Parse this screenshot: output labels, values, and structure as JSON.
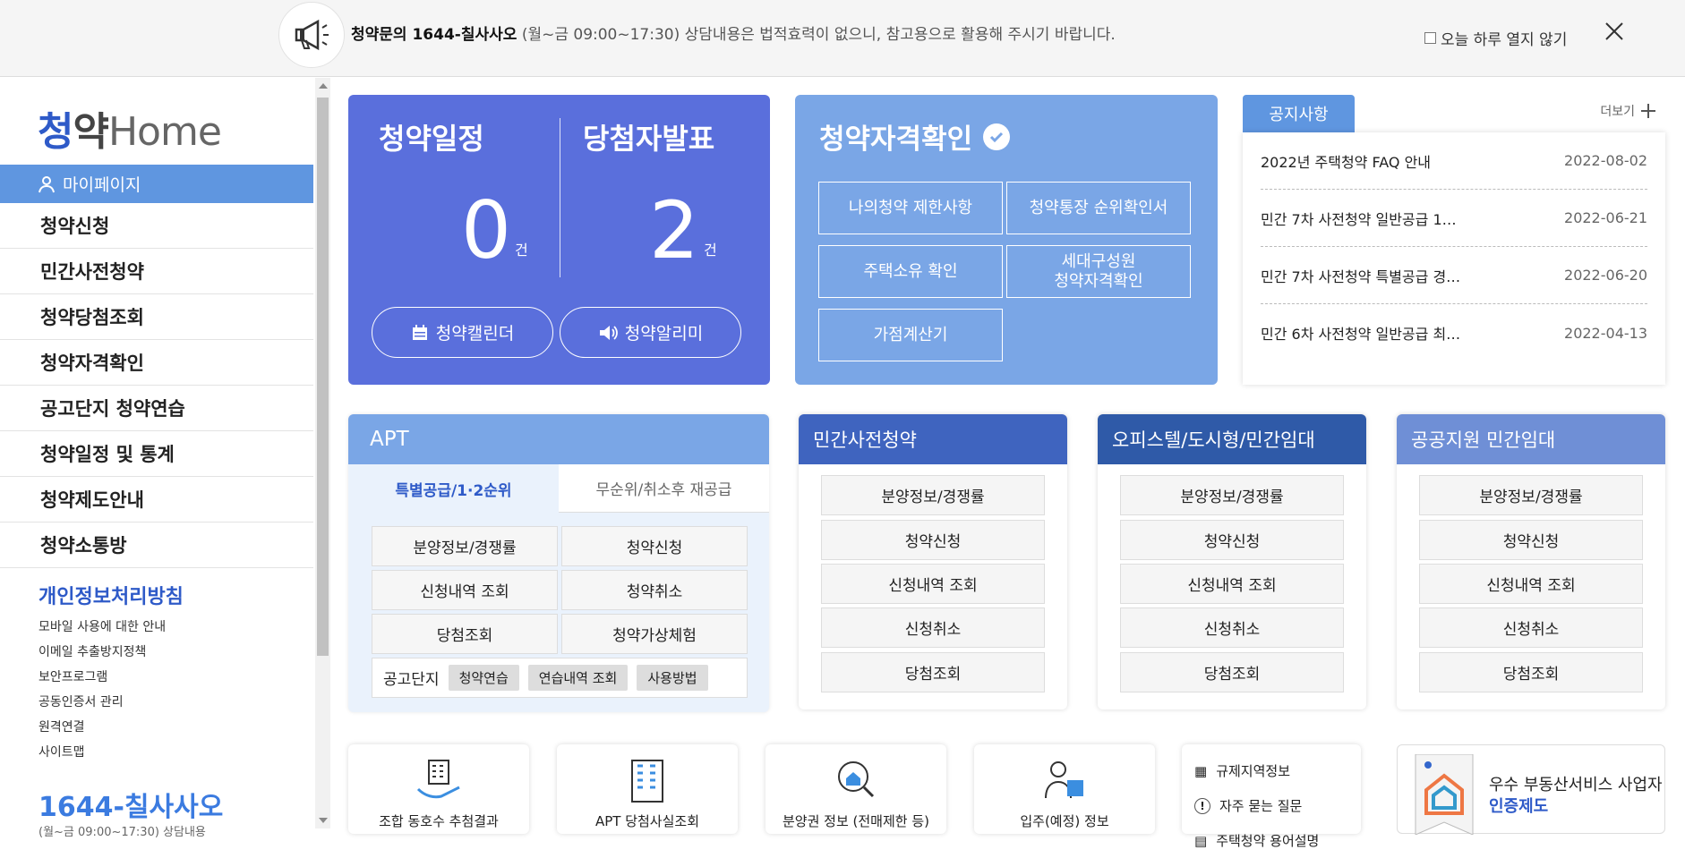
{
  "topbar": {
    "notice_bold": "청약문의 1644-칠사사오",
    "notice_rest": " (월~금 09:00~17:30) 상담내용은 법적효력이 없으니, 참고용으로 활용해 주시기 바랍니다.",
    "dismiss_label": "오늘 하루 열지 않기"
  },
  "sidebar": {
    "logo_1": "청",
    "logo_2": "약",
    "logo_3": "Home",
    "mypage": "마이페이지",
    "menu": [
      "청약신청",
      "민간사전청약",
      "청약당첨조회",
      "청약자격확인",
      "공고단지 청약연습",
      "청약일정 및 통계",
      "청약제도안내",
      "청약소통방"
    ],
    "policy": "개인정보처리방침",
    "links": [
      "모바일 사용에 대한 안내",
      "이메일 추출방지정책",
      "보안프로그램",
      "공동인증서 관리",
      "원격연결",
      "사이트맵"
    ],
    "phone": "1644-칠사사오",
    "phone_sub": "(월~금 09:00~17:30) 상담내용"
  },
  "schedule": {
    "title1": "청약일정",
    "title2": "당첨자발표",
    "count1": "0",
    "count2": "2",
    "unit": "건",
    "btn_calendar": "청약캘린더",
    "btn_alarm": "청약알리미"
  },
  "qualify": {
    "title": "청약자격확인",
    "btn1": "나의청약 제한사항",
    "btn2": "청약통장 순위확인서",
    "btn3": "주택소유 확인",
    "btn4a": "세대구성원",
    "btn4b": "청약자격확인",
    "btn5": "가점계산기"
  },
  "notice": {
    "tab": "공지사항",
    "more": "더보기",
    "rows": [
      {
        "title": "2022년 주택청약 FAQ 안내",
        "date": "2022-08-02"
      },
      {
        "title": "민간 7차 사전청약 일반공급 1…",
        "date": "2022-06-21"
      },
      {
        "title": "민간 7차 사전청약 특별공급 경…",
        "date": "2022-06-20"
      },
      {
        "title": "민간 6차 사전청약 일반공급 최…",
        "date": "2022-04-13"
      }
    ]
  },
  "apt": {
    "title": "APT",
    "tab_on": "특별공급/1·2순위",
    "tab_off": "무순위/취소후 재공급",
    "cells": [
      "분양정보/경쟁률",
      "청약신청",
      "신청내역 조회",
      "청약취소",
      "당첨조회",
      "청약가상체험"
    ],
    "complex_label": "공고단지",
    "complex_btns": [
      "청약연습",
      "연습내역 조회",
      "사용방법"
    ]
  },
  "panels": [
    {
      "title": "민간사전청약",
      "items": [
        "분양정보/경쟁률",
        "청약신청",
        "신청내역 조회",
        "신청취소",
        "당첨조회"
      ]
    },
    {
      "title": "오피스텔/도시형/민간임대",
      "items": [
        "분양정보/경쟁률",
        "청약신청",
        "신청내역 조회",
        "신청취소",
        "당첨조회"
      ]
    },
    {
      "title": "공공지원 민간임대",
      "items": [
        "분양정보/경쟁률",
        "청약신청",
        "신청내역 조회",
        "신청취소",
        "당첨조회"
      ]
    }
  ],
  "quick": [
    "조합 동호수 추첨결과",
    "APT 당첨사실조회",
    "분양권 정보 (전매제한 등)",
    "입주(예정) 정보"
  ],
  "quicklist": [
    "규제지역정보",
    "자주 묻는 질문",
    "주택청약 용어설명"
  ],
  "cert": {
    "line1": "우수 부동산서비스 사업자",
    "line2": "인증제도",
    "badge": "국토교통부"
  }
}
